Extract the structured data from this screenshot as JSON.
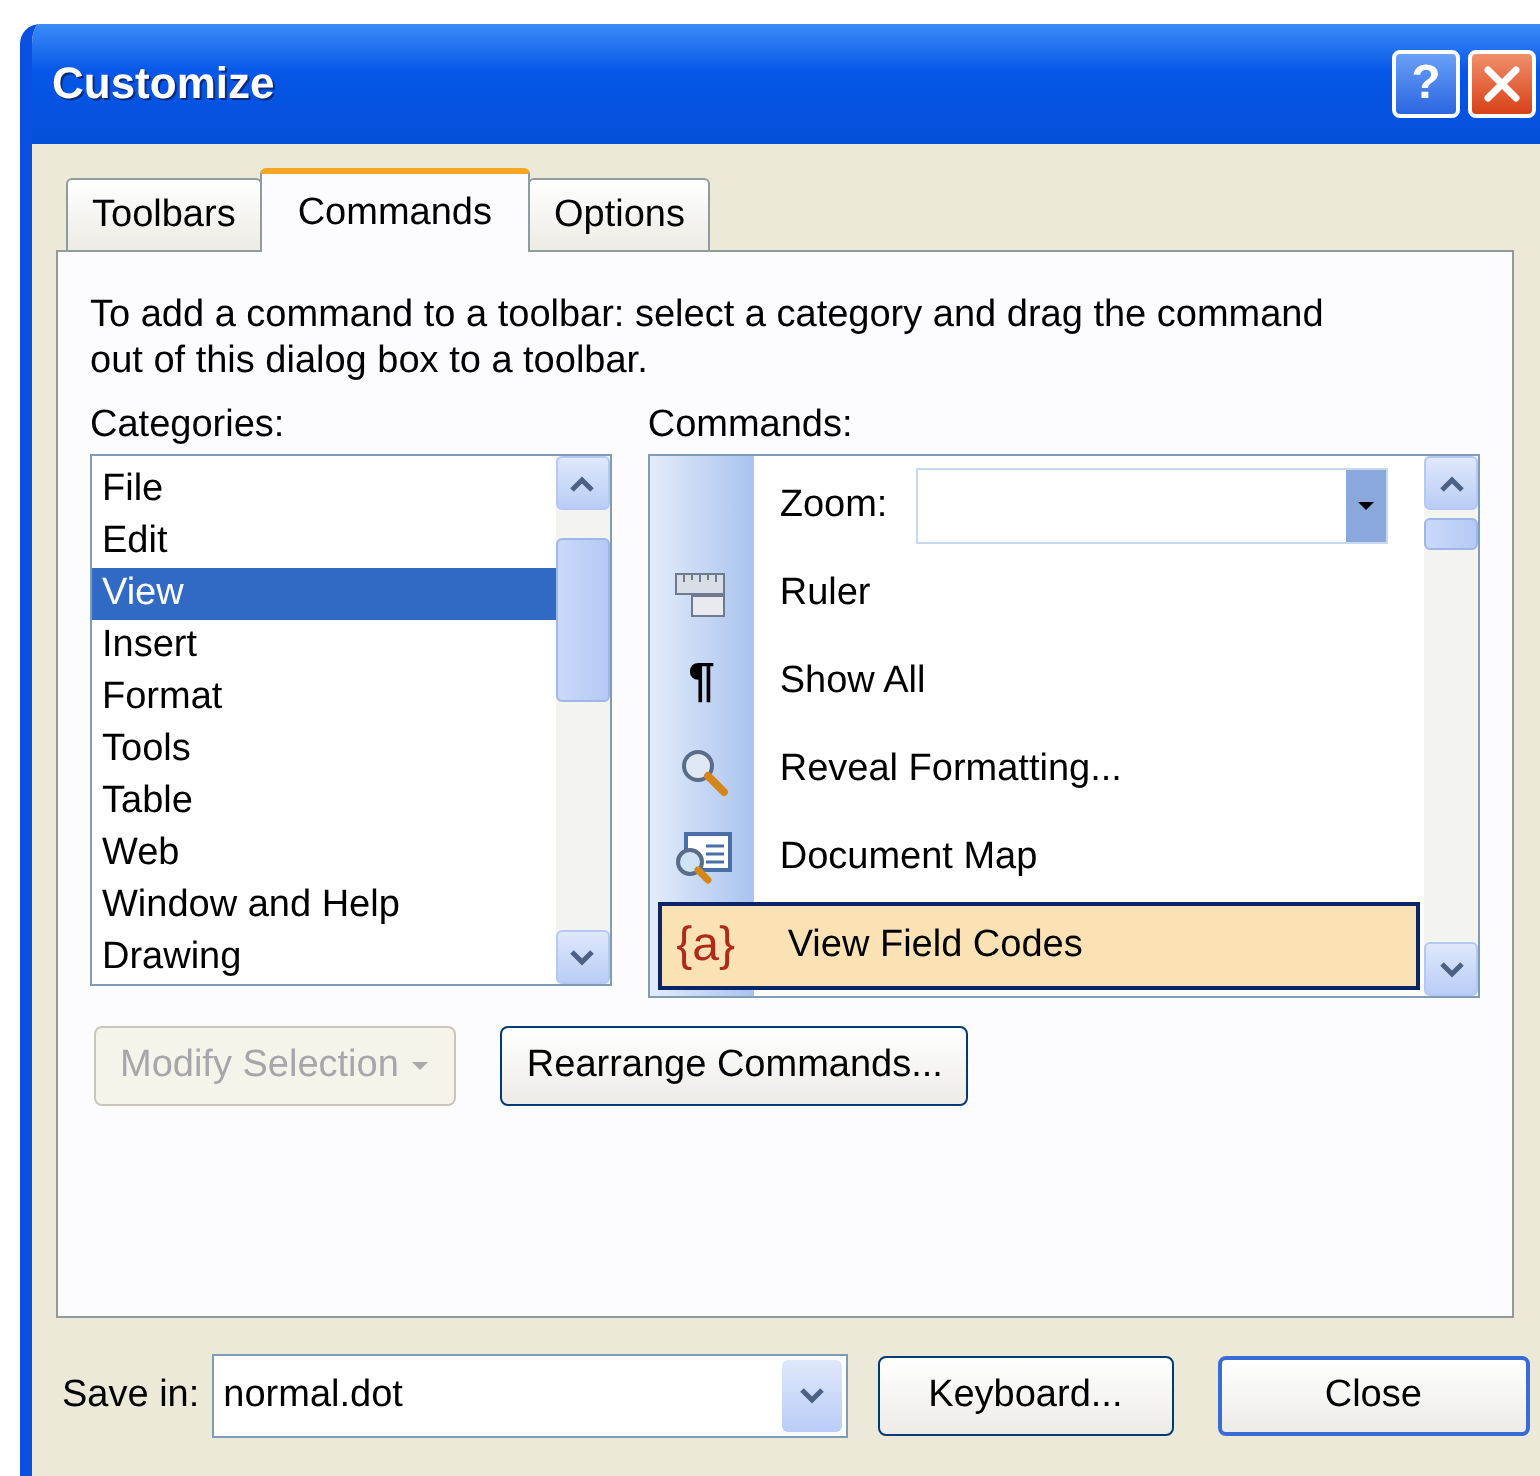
{
  "window": {
    "title": "Customize",
    "help_button": "?"
  },
  "tabs": [
    {
      "label": "Toolbars",
      "selected": false
    },
    {
      "label": "Commands",
      "selected": true
    },
    {
      "label": "Options",
      "selected": false
    }
  ],
  "instructions": "To add a command to a toolbar: select a category and drag the command out of this dialog box to a toolbar.",
  "categories": {
    "label": "Categories:",
    "items": [
      {
        "label": "File",
        "selected": false
      },
      {
        "label": "Edit",
        "selected": false
      },
      {
        "label": "View",
        "selected": true
      },
      {
        "label": "Insert",
        "selected": false
      },
      {
        "label": "Format",
        "selected": false
      },
      {
        "label": "Tools",
        "selected": false
      },
      {
        "label": "Table",
        "selected": false
      },
      {
        "label": "Web",
        "selected": false
      },
      {
        "label": "Window and Help",
        "selected": false
      },
      {
        "label": "Drawing",
        "selected": false
      }
    ]
  },
  "commands": {
    "label": "Commands:",
    "items": [
      {
        "kind": "combo",
        "label": "Zoom:",
        "selected": false
      },
      {
        "kind": "command",
        "label": "Ruler",
        "selected": false
      },
      {
        "kind": "command",
        "label": "Show All",
        "icon_text": "¶",
        "selected": false
      },
      {
        "kind": "command",
        "label": "Reveal Formatting...",
        "selected": false
      },
      {
        "kind": "command",
        "label": "Document Map",
        "selected": false
      },
      {
        "kind": "command",
        "label": "View Field Codes",
        "icon_text": "{a}",
        "selected": true
      }
    ]
  },
  "buttons": [
    {
      "label": "Modify Selection",
      "dropdown": true,
      "disabled": true
    },
    {
      "label": "Rearrange Commands...",
      "dropdown": false,
      "disabled": false
    }
  ],
  "footer": {
    "save_in_label": "Save in:",
    "save_in_value": "normal.dot",
    "buttons": [
      {
        "label": "Keyboard..."
      },
      {
        "label": "Close"
      }
    ]
  }
}
